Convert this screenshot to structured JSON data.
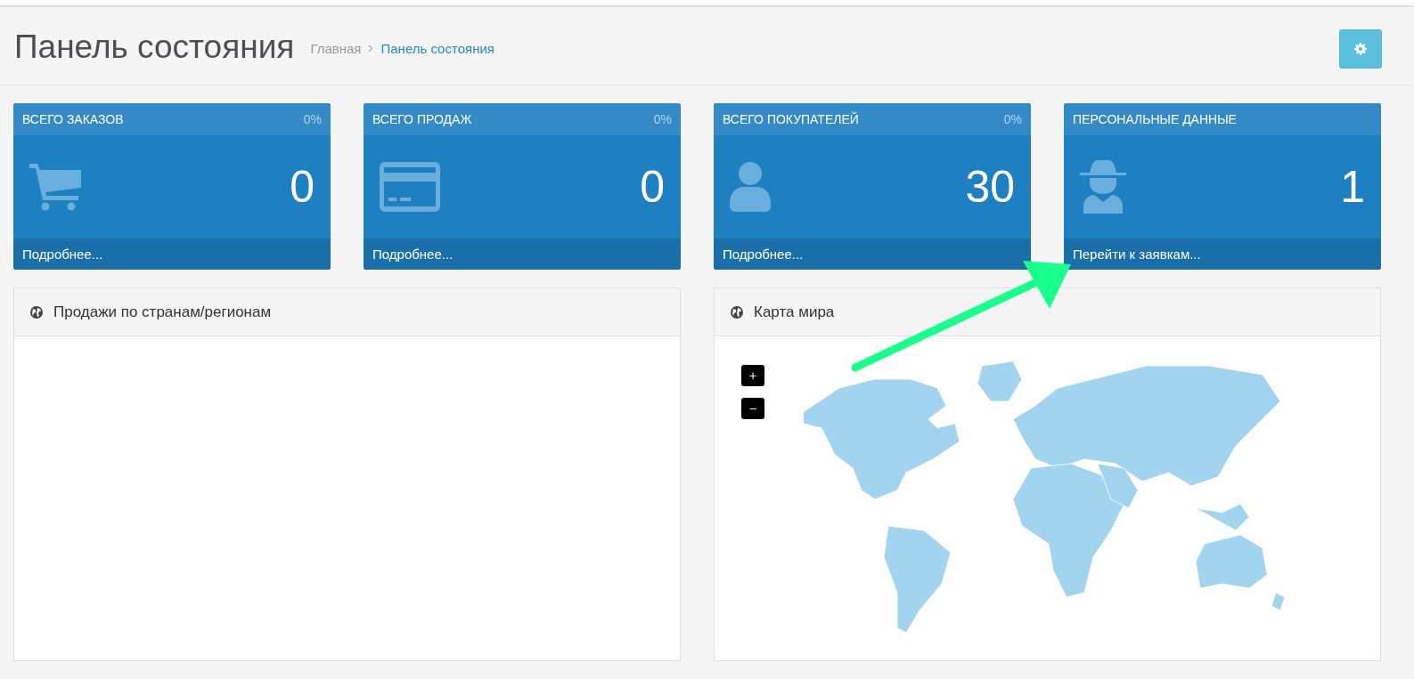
{
  "header": {
    "title": "Панель состояния",
    "breadcrumb": [
      {
        "label": "Главная",
        "current": false
      },
      {
        "label": "Панель состояния",
        "current": true
      }
    ]
  },
  "tiles": [
    {
      "title": "ВСЕГО ЗАКАЗОВ",
      "percent": "0%",
      "value": "0",
      "link": "Подробнее...",
      "kind": "cart"
    },
    {
      "title": "ВСЕГО ПРОДАЖ",
      "percent": "0%",
      "value": "0",
      "link": "Подробнее...",
      "kind": "card"
    },
    {
      "title": "ВСЕГО ПОКУПАТЕЛЕЙ",
      "percent": "0%",
      "value": "30",
      "link": "Подробнее...",
      "kind": "user"
    },
    {
      "title": "ПЕРСОНАЛЬНЫЕ ДАННЫЕ",
      "value": "1",
      "link": "Перейти к заявкам...",
      "kind": "spy"
    }
  ],
  "panels": [
    {
      "title": "Продажи по странам/регионам",
      "kind": "empty"
    },
    {
      "title": "Карта мира",
      "kind": "map",
      "zoom_in": "+",
      "zoom_out": "−"
    }
  ]
}
